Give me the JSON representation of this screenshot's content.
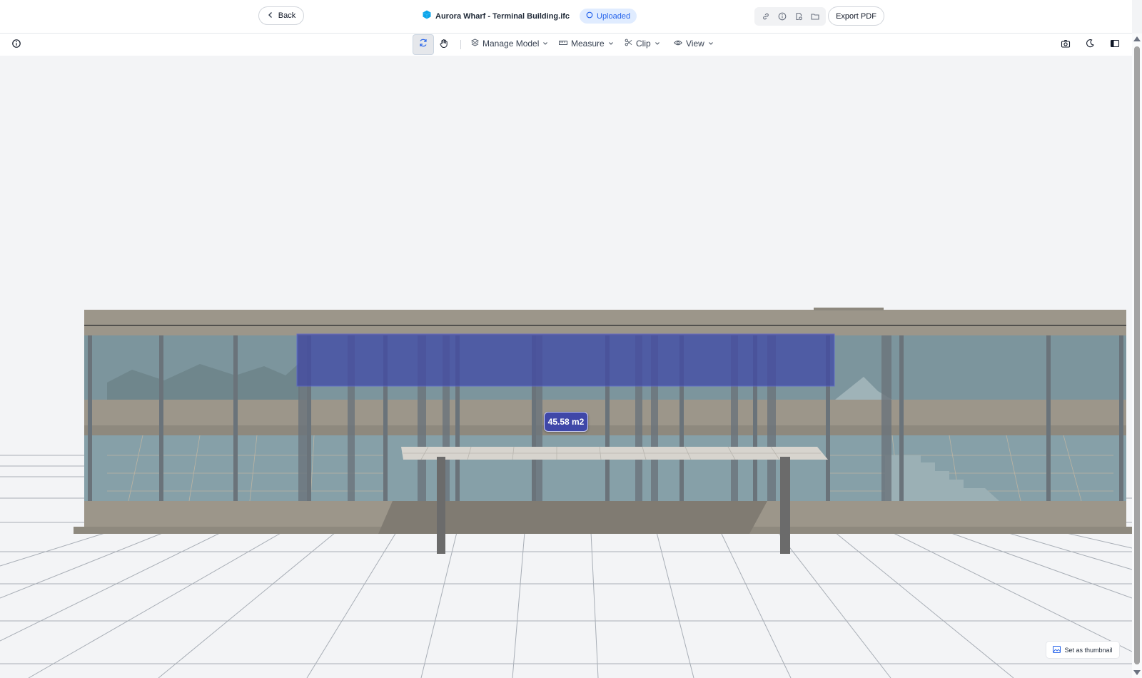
{
  "header": {
    "back_label": "Back",
    "file_title": "Aurora Wharf - Terminal Building.ifc",
    "status": "Uploaded",
    "export_label": "Export PDF",
    "icons": [
      "link-icon",
      "info-icon",
      "file-edit-icon",
      "folder-icon"
    ]
  },
  "toolbar": {
    "manage_model": "Manage Model",
    "measure": "Measure",
    "clip": "Clip",
    "view": "View",
    "right_icons": [
      "camera-icon",
      "moon-icon",
      "panel-icon"
    ]
  },
  "viewport": {
    "measurement": "45.58 m2",
    "thumbnail_label": "Set as thumbnail"
  },
  "colors": {
    "accent": "#2563eb",
    "measure_fill": "#3f47a8",
    "building_stone": "#9c968a",
    "glass": "#7a9199"
  }
}
